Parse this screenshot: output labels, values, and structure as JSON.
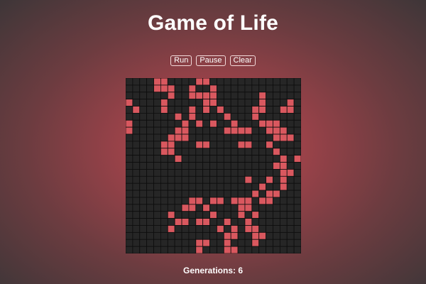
{
  "title": "Game of Life",
  "controls": {
    "run_label": "Run",
    "pause_label": "Pause",
    "clear_label": "Clear"
  },
  "board": {
    "rows": 25,
    "cols": 25,
    "live_color": "#d9585f",
    "dead_color": "#262626",
    "grid_color": "#0d0d0d",
    "live_cells": [
      [
        0,
        4
      ],
      [
        0,
        5
      ],
      [
        0,
        10
      ],
      [
        0,
        11
      ],
      [
        1,
        4
      ],
      [
        1,
        5
      ],
      [
        1,
        6
      ],
      [
        1,
        9
      ],
      [
        1,
        12
      ],
      [
        2,
        6
      ],
      [
        2,
        9
      ],
      [
        2,
        10
      ],
      [
        2,
        11
      ],
      [
        2,
        12
      ],
      [
        2,
        19
      ],
      [
        3,
        0
      ],
      [
        3,
        5
      ],
      [
        3,
        11
      ],
      [
        3,
        12
      ],
      [
        3,
        19
      ],
      [
        3,
        23
      ],
      [
        4,
        1
      ],
      [
        4,
        5
      ],
      [
        4,
        9
      ],
      [
        4,
        11
      ],
      [
        4,
        13
      ],
      [
        4,
        18
      ],
      [
        4,
        19
      ],
      [
        4,
        22
      ],
      [
        4,
        23
      ],
      [
        5,
        7
      ],
      [
        5,
        9
      ],
      [
        5,
        14
      ],
      [
        5,
        18
      ],
      [
        6,
        0
      ],
      [
        6,
        8
      ],
      [
        6,
        10
      ],
      [
        6,
        12
      ],
      [
        6,
        15
      ],
      [
        6,
        19
      ],
      [
        6,
        20
      ],
      [
        6,
        21
      ],
      [
        7,
        0
      ],
      [
        7,
        7
      ],
      [
        7,
        8
      ],
      [
        7,
        14
      ],
      [
        7,
        15
      ],
      [
        7,
        16
      ],
      [
        7,
        17
      ],
      [
        7,
        20
      ],
      [
        7,
        21
      ],
      [
        7,
        22
      ],
      [
        8,
        6
      ],
      [
        8,
        7
      ],
      [
        8,
        8
      ],
      [
        8,
        21
      ],
      [
        8,
        22
      ],
      [
        8,
        23
      ],
      [
        9,
        5
      ],
      [
        9,
        6
      ],
      [
        9,
        10
      ],
      [
        9,
        11
      ],
      [
        9,
        16
      ],
      [
        9,
        17
      ],
      [
        9,
        20
      ],
      [
        10,
        5
      ],
      [
        10,
        6
      ],
      [
        10,
        21
      ],
      [
        11,
        7
      ],
      [
        11,
        22
      ],
      [
        11,
        24
      ],
      [
        12,
        21
      ],
      [
        12,
        22
      ],
      [
        13,
        22
      ],
      [
        13,
        23
      ],
      [
        14,
        17
      ],
      [
        14,
        20
      ],
      [
        14,
        22
      ],
      [
        15,
        19
      ],
      [
        15,
        22
      ],
      [
        16,
        18
      ],
      [
        16,
        20
      ],
      [
        16,
        21
      ],
      [
        17,
        9
      ],
      [
        17,
        10
      ],
      [
        17,
        12
      ],
      [
        17,
        13
      ],
      [
        17,
        15
      ],
      [
        17,
        16
      ],
      [
        17,
        17
      ],
      [
        17,
        19
      ],
      [
        17,
        20
      ],
      [
        18,
        8
      ],
      [
        18,
        9
      ],
      [
        18,
        11
      ],
      [
        18,
        16
      ],
      [
        18,
        17
      ],
      [
        19,
        6
      ],
      [
        19,
        12
      ],
      [
        19,
        16
      ],
      [
        19,
        18
      ],
      [
        20,
        7
      ],
      [
        20,
        8
      ],
      [
        20,
        10
      ],
      [
        20,
        11
      ],
      [
        20,
        14
      ],
      [
        20,
        17
      ],
      [
        21,
        6
      ],
      [
        21,
        13
      ],
      [
        21,
        15
      ],
      [
        21,
        17
      ],
      [
        21,
        18
      ],
      [
        22,
        14
      ],
      [
        22,
        15
      ],
      [
        22,
        18
      ],
      [
        22,
        19
      ],
      [
        23,
        10
      ],
      [
        23,
        11
      ],
      [
        23,
        14
      ],
      [
        23,
        18
      ],
      [
        24,
        10
      ],
      [
        24,
        14
      ],
      [
        24,
        15
      ]
    ]
  },
  "status": {
    "generations_text": "Generations: 6"
  }
}
